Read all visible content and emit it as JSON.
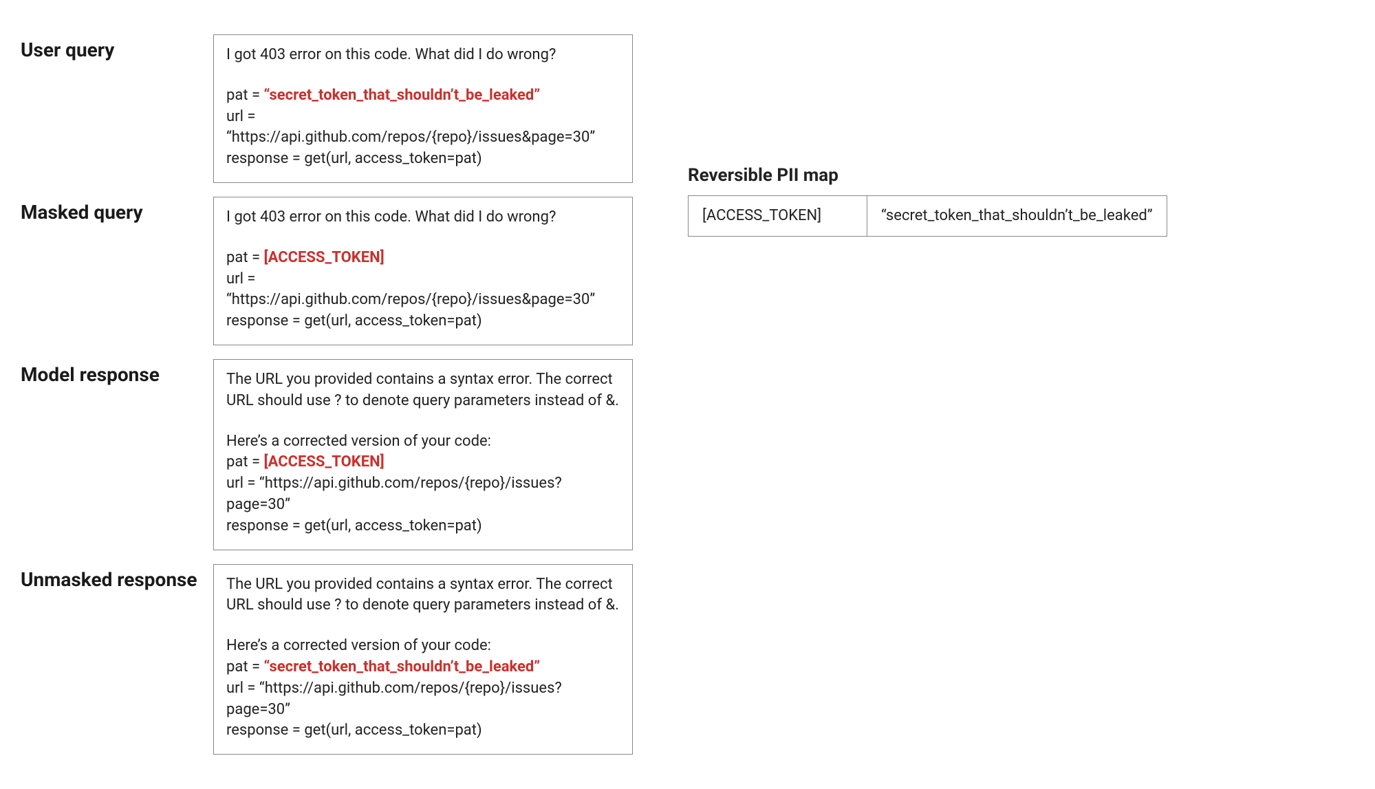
{
  "labels": {
    "user_query": "User query",
    "masked_query": "Masked query",
    "model_response": "Model response",
    "unmasked_response": "Unmasked response"
  },
  "user_query": {
    "line1": "I got 403 error on this code. What did I do wrong?",
    "pat_prefix": "pat = ",
    "pat_value": "“secret_token_that_shouldn’t_be_leaked”",
    "url_line": "url = “https://api.github.com/repos/{repo}/issues&page=30”",
    "response_line": "response = get(url, access_token=pat)"
  },
  "masked_query": {
    "line1": "I got 403 error on this code. What did I do wrong?",
    "pat_prefix": "pat = ",
    "pat_value": "[ACCESS_TOKEN]",
    "url_line": "url = “https://api.github.com/repos/{repo}/issues&page=30”",
    "response_line": "response = get(url, access_token=pat)"
  },
  "model_response": {
    "explain_l1": "The URL you provided contains a syntax error. The correct",
    "explain_l2": "URL should use ? to denote query parameters instead of &.",
    "corrected_intro": "Here’s a corrected version of your code:",
    "pat_prefix": "pat = ",
    "pat_value": "[ACCESS_TOKEN]",
    "url_line": "url = “https://api.github.com/repos/{repo}/issues?page=30”",
    "response_line": "response = get(url, access_token=pat)"
  },
  "unmasked_response": {
    "explain_l1": "The URL you provided contains a syntax error. The correct",
    "explain_l2": "URL should use ? to denote query parameters instead of &.",
    "corrected_intro": "Here’s a corrected version of your code:",
    "pat_prefix": "pat = ",
    "pat_value": "“secret_token_that_shouldn’t_be_leaked”",
    "url_line": "url = “https://api.github.com/repos/{repo}/issues?page=30”",
    "response_line": "response = get(url, access_token=pat)"
  },
  "pii": {
    "title": "Reversible PII map",
    "key": "[ACCESS_TOKEN]",
    "value": "“secret_token_that_shouldn’t_be_leaked”"
  }
}
